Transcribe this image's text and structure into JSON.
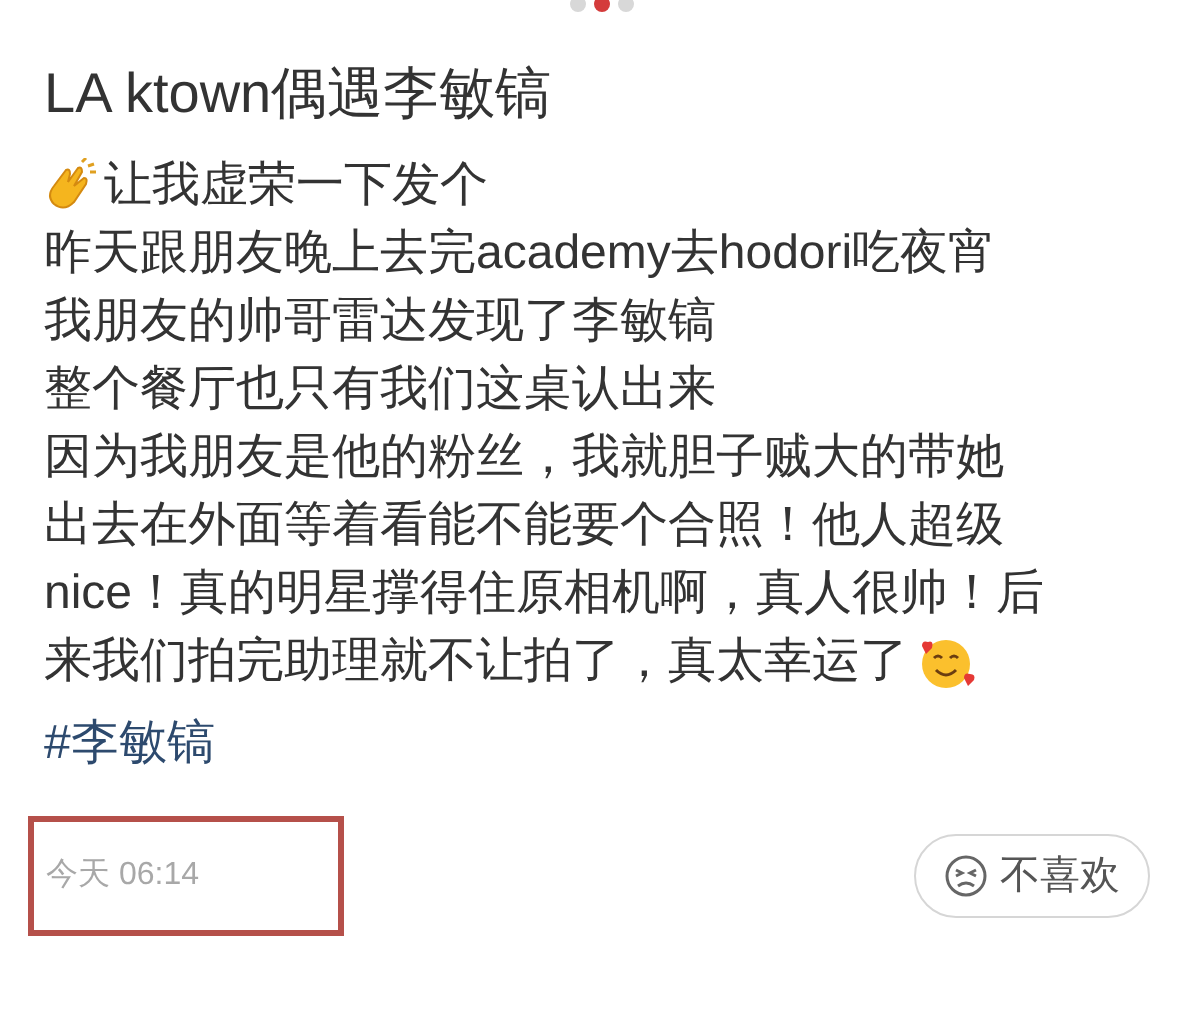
{
  "carousel": {
    "dots": [
      {
        "selected": false
      },
      {
        "selected": true
      },
      {
        "selected": false
      }
    ]
  },
  "post": {
    "title": "LA ktown偶遇李敏镐",
    "lines": [
      {
        "kind": "clapping",
        "text": "让我虚荣一下发个"
      },
      {
        "kind": "plain",
        "text": "昨天跟朋友晚上去完academy去hodori吃夜宵"
      },
      {
        "kind": "plain",
        "text": "我朋友的帅哥雷达发现了李敏镐"
      },
      {
        "kind": "plain",
        "text": "整个餐厅也只有我们这桌认出来"
      },
      {
        "kind": "plain",
        "text": "因为我朋友是他的粉丝，我就胆子贼大的带她"
      },
      {
        "kind": "plain",
        "text": "出去在外面等着看能不能要个合照！他人超级"
      },
      {
        "kind": "plain",
        "text": "nice！真的明星撑得住原相机啊，真人很帅！后"
      },
      {
        "kind": "hearts",
        "text": "来我们拍完助理就不让拍了，真太幸运了"
      }
    ],
    "hashtag": "#李敏镐",
    "time": "今天 06:14",
    "time_highlighted": true,
    "dislike_button": "不喜欢"
  }
}
